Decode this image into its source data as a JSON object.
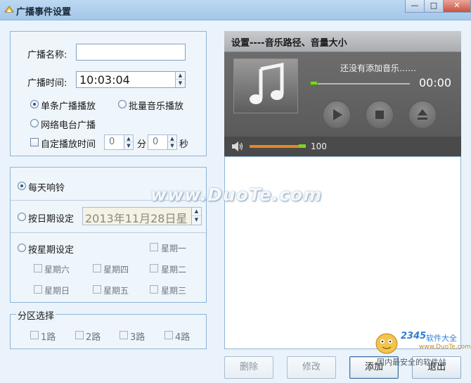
{
  "window": {
    "title": "广播事件设置",
    "minimize_glyph": "—",
    "maximize_glyph": "□",
    "close_glyph": "✕"
  },
  "broadcast": {
    "name_label": "广播名称:",
    "name_value": "",
    "time_label": "广播时间:",
    "time_value": "10:03:04",
    "mode_single": "单条广播播放",
    "mode_batch": "批量音乐播放",
    "mode_radio": "网络电台广播",
    "mode_selected": "单条广播播放",
    "custom_time_label": "自定播放时间",
    "custom_time_checked": false,
    "minutes_value": "0",
    "minutes_unit": "分",
    "seconds_value": "0",
    "seconds_unit": "秒"
  },
  "schedule": {
    "daily_label": "每天响铃",
    "by_date_label": "按日期设定",
    "date_value": "2013年11月28日星",
    "by_week_label": "按星期设定",
    "selected": "每天响铃",
    "weekdays": [
      "星期一",
      "星期二",
      "星期三",
      "星期四",
      "星期五",
      "星期六",
      "星期日"
    ]
  },
  "zones": {
    "legend": "分区选择",
    "items": [
      "1路",
      "2路",
      "3路",
      "4路"
    ]
  },
  "player": {
    "header": "设置----音乐路径、音量大小",
    "status_text": "还没有添加音乐……",
    "time_display": "00:00",
    "progress": 0,
    "volume": 100,
    "volume_text": "100",
    "icons": [
      "music-note-icon",
      "play-icon",
      "stop-icon",
      "eject-icon",
      "speaker-icon"
    ]
  },
  "buttons": {
    "delete": "删除",
    "edit": "修改",
    "add": "添加",
    "exit": "退出"
  },
  "watermarks": {
    "site": "www.DuoTe.com",
    "brand_number": "2345",
    "brand_name": "软件大全",
    "brand_site": "www.DuoTe.com",
    "brand_slogan": "国内最安全的软件站"
  }
}
